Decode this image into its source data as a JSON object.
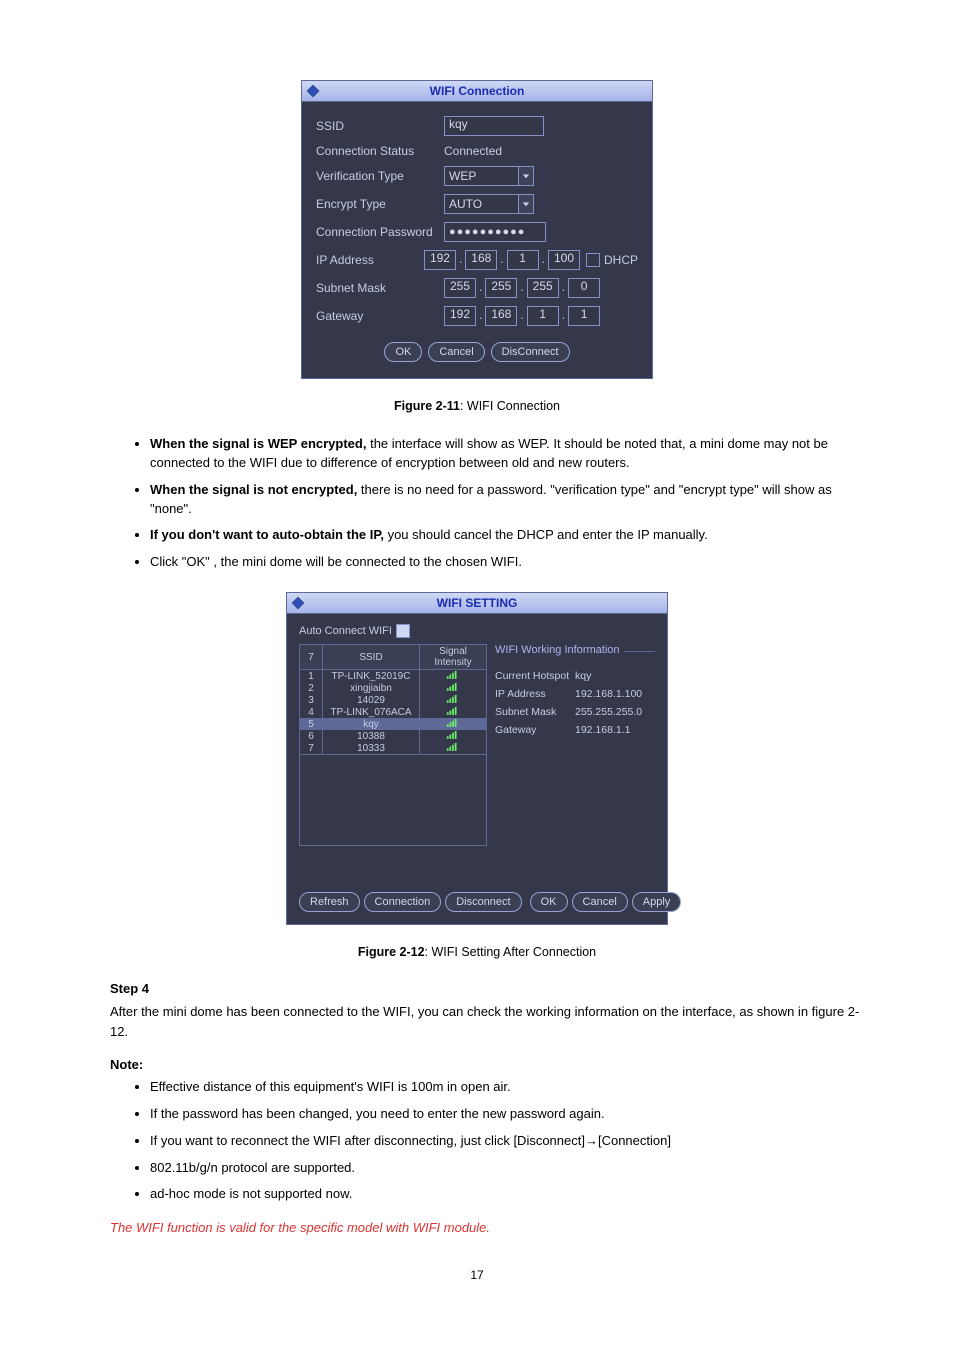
{
  "dialog1": {
    "title": "WIFI Connection",
    "labels": {
      "ssid": "SSID",
      "connstatus": "Connection Status",
      "verification": "Verification Type",
      "encrypt": "Encrypt Type",
      "password": "Connection Password",
      "ip": "IP Address",
      "subnet": "Subnet Mask",
      "gateway": "Gateway",
      "dhcp": "DHCP"
    },
    "values": {
      "ssid": "kqy",
      "connstatus": "Connected",
      "verification": "WEP",
      "encrypt": "AUTO",
      "password": "●●●●●●●●●●",
      "ip": [
        "192",
        "168",
        "1",
        "100"
      ],
      "subnet": [
        "255",
        "255",
        "255",
        "0"
      ],
      "gateway": [
        "192",
        "168",
        "1",
        "1"
      ]
    },
    "buttons": {
      "ok": "OK",
      "cancel": "Cancel",
      "disconnect": "DisConnect"
    }
  },
  "fig1": {
    "label": "Figure 2-11",
    "text": ": WIFI Connection"
  },
  "bullets1": [
    {
      "head": "When the signal is WEP encrypted,",
      "tail": " the interface will show as WEP. It should be noted that, a mini dome may not be connected to the WIFI due to difference of encryption between old and new routers."
    },
    {
      "head": "When the signal is not encrypted,",
      "tail": " there is no need for a password. \"verification type\" and \"encrypt type\" will show as \"none\"."
    },
    {
      "head": "If you don't want to auto-obtain the IP,",
      "tail": " you should cancel the DHCP and enter the IP manually."
    },
    {
      "head": "",
      "tail": "Click \"OK\" , the mini dome will be connected to the chosen WIFI."
    }
  ],
  "dialog2": {
    "title": "WIFI SETTING",
    "auto_label": "Auto Connect WIFI",
    "table": {
      "headers": [
        "7",
        "SSID",
        "Signal Intensity"
      ],
      "rows": [
        {
          "n": "1",
          "ssid": "TP-LINK_52019C",
          "sel": false
        },
        {
          "n": "2",
          "ssid": "xingjiaibn",
          "sel": false
        },
        {
          "n": "3",
          "ssid": "14029",
          "sel": false
        },
        {
          "n": "4",
          "ssid": "TP-LINK_076ACA",
          "sel": false
        },
        {
          "n": "5",
          "ssid": "kqy",
          "sel": true
        },
        {
          "n": "6",
          "ssid": "10388",
          "sel": false
        },
        {
          "n": "7",
          "ssid": "10333",
          "sel": false
        }
      ]
    },
    "info_title": "WIFI Working Information",
    "info": {
      "hotspot_lbl": "Current Hotspot",
      "hotspot_val": "kqy",
      "ip_lbl": "IP Address",
      "ip_val": "192.168.1.100",
      "subnet_lbl": "Subnet Mask",
      "subnet_val": "255.255.255.0",
      "gateway_lbl": "Gateway",
      "gateway_val": "192.168.1.1"
    },
    "buttons": {
      "refresh": "Refresh",
      "connection": "Connection",
      "disconnect": "Disconnect",
      "ok": "OK",
      "cancel": "Cancel",
      "apply": "Apply"
    }
  },
  "fig2": {
    "label": "Figure 2-12",
    "text": ": WIFI Setting After Connection"
  },
  "step4": "Step 4",
  "step4_text": "After the mini dome has been connected to the WIFI, you can check the working information on the interface, as shown in figure 2-12.",
  "note_label": "Note:",
  "bullets2": [
    "Effective distance of this equipment's WIFI is 100m in open air.",
    "If the password has been changed, you need to enter the new password again.",
    "If you want to reconnect the WIFI after disconnecting, just click [Disconnect]→[Connection]",
    "802.11b/g/n protocol are supported.",
    "ad-hoc mode is not supported now."
  ],
  "red_text": "The WIFI function is valid for the specific model with WIFI module.",
  "page_num": "17"
}
